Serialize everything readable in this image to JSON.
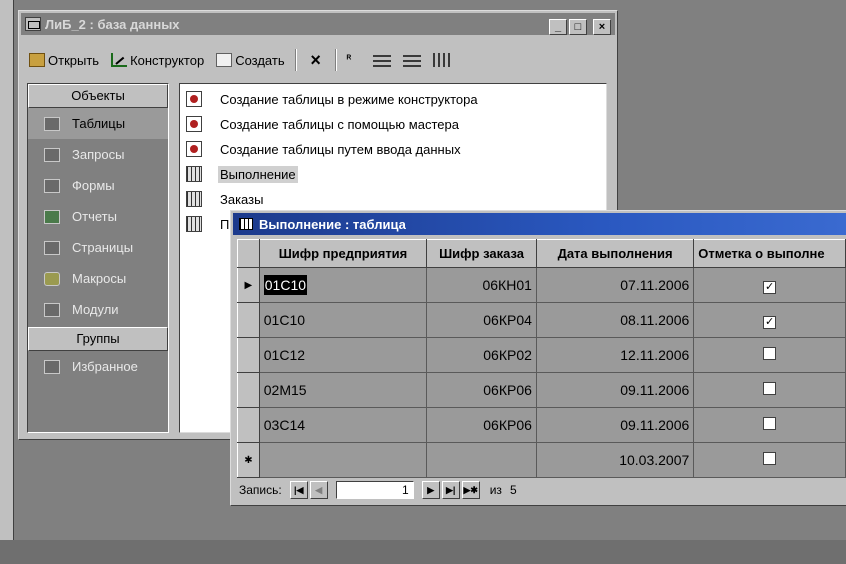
{
  "db_window": {
    "title": "ЛиБ_2 : база данных",
    "controls": [
      "_",
      "□",
      "×"
    ]
  },
  "toolbar": {
    "open": "Открыть",
    "design": "Конструктор",
    "new": "Создать",
    "delete_icon": "×"
  },
  "objects": {
    "header": "Объекты",
    "items": [
      "Таблицы",
      "Запросы",
      "Формы",
      "Отчеты",
      "Страницы",
      "Макросы",
      "Модули"
    ],
    "selected": "Таблицы",
    "groups_header": "Группы",
    "groups": [
      "Избранное"
    ]
  },
  "object_list": [
    {
      "label": "Создание таблицы в режиме конструктора",
      "icon": "wizard-icon"
    },
    {
      "label": "Создание таблицы с помощью мастера",
      "icon": "wizard-icon"
    },
    {
      "label": "Создание таблицы путем ввода данных",
      "icon": "wizard-icon"
    },
    {
      "label": "Выполнение",
      "icon": "table-icon"
    },
    {
      "label": "Заказы",
      "icon": "table-icon"
    },
    {
      "label": "П",
      "icon": "table-icon"
    }
  ],
  "table_window": {
    "title": "Выполнение : таблица",
    "columns": [
      "Шифр предприятия",
      "Шифр заказа",
      "Дата выполнения",
      "Отметка о выполне"
    ],
    "rows": [
      {
        "company": "01С10",
        "order": "06КН01",
        "date": "07.11.2006",
        "done": "✓"
      },
      {
        "company": "01С10",
        "order": "06КР04",
        "date": "08.11.2006",
        "done": "✓"
      },
      {
        "company": "01С12",
        "order": "06КР02",
        "date": "12.11.2006",
        "done": ""
      },
      {
        "company": "02М15",
        "order": "06КР06",
        "date": "09.11.2006",
        "done": ""
      },
      {
        "company": "03С14",
        "order": "06КР06",
        "date": "09.11.2006",
        "done": ""
      }
    ],
    "new_row": {
      "date": "10.03.2007",
      "done": ""
    },
    "current_row_marker": "▶",
    "new_row_marker": "✱",
    "navigator": {
      "label": "Запись:",
      "current": "1",
      "of_label": "из",
      "total": "5",
      "btn_first": "|◀",
      "btn_prev": "◀",
      "btn_next": "▶",
      "btn_last": "▶|",
      "btn_new": "▶✱"
    }
  }
}
